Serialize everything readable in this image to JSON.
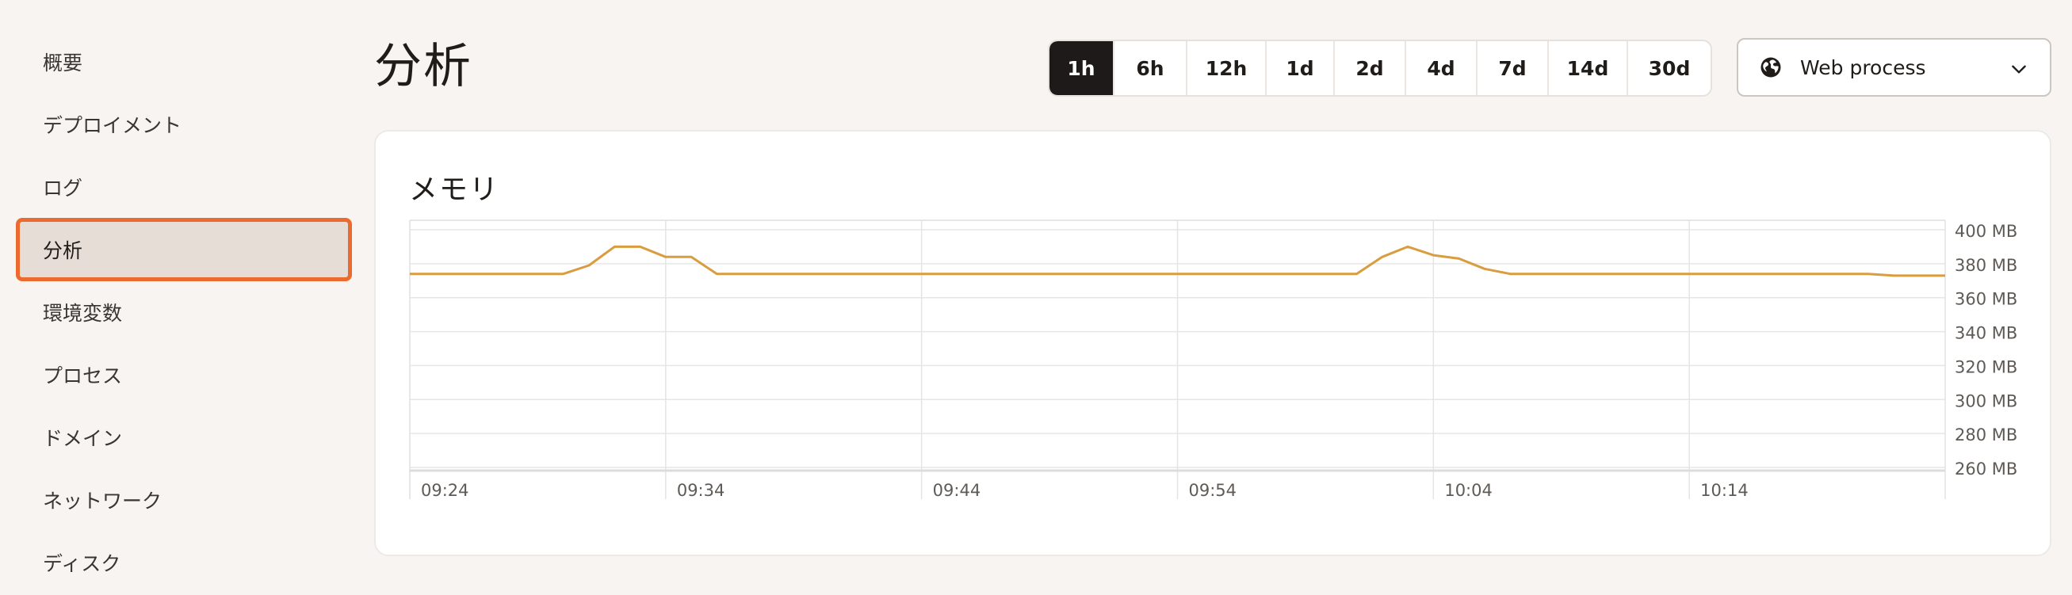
{
  "sidebar": {
    "items": [
      {
        "label": "概要",
        "name": "sidebar-item-overview",
        "active": false
      },
      {
        "label": "デプロイメント",
        "name": "sidebar-item-deployments",
        "active": false
      },
      {
        "label": "ログ",
        "name": "sidebar-item-logs",
        "active": false
      },
      {
        "label": "分析",
        "name": "sidebar-item-analytics",
        "active": true
      },
      {
        "label": "環境変数",
        "name": "sidebar-item-env-vars",
        "active": false
      },
      {
        "label": "プロセス",
        "name": "sidebar-item-processes",
        "active": false
      },
      {
        "label": "ドメイン",
        "name": "sidebar-item-domains",
        "active": false
      },
      {
        "label": "ネットワーク",
        "name": "sidebar-item-network",
        "active": false
      },
      {
        "label": "ディスク",
        "name": "sidebar-item-disk",
        "active": false
      }
    ]
  },
  "header": {
    "title": "分析",
    "ranges": [
      "1h",
      "6h",
      "12h",
      "1d",
      "2d",
      "4d",
      "7d",
      "14d",
      "30d"
    ],
    "active_range": "1h",
    "process_select": {
      "value": "Web process",
      "icon": "globe-icon",
      "chevron": "chevron-down-icon"
    }
  },
  "card": {
    "title": "メモリ"
  },
  "colors": {
    "line": "#d99c3f",
    "active_range_bg": "#1d1a19",
    "active_outline": "#ec6a2d",
    "grid": "#e8e8e8"
  },
  "chart_data": {
    "type": "line",
    "x_tick_labels": [
      "09:24",
      "09:34",
      "09:44",
      "09:54",
      "10:04",
      "10:14"
    ],
    "y_tick_labels": [
      "400 MB",
      "380 MB",
      "360 MB",
      "340 MB",
      "320 MB",
      "300 MB",
      "280 MB",
      "260 MB"
    ],
    "ylim": [
      260,
      400
    ],
    "x_start": "09:24",
    "x_end": "10:24",
    "grid": true,
    "series": [
      {
        "color": "#d99c3f",
        "x": [
          "09:24",
          "09:25",
          "09:26",
          "09:27",
          "09:28",
          "09:29",
          "09:30",
          "09:31",
          "09:32",
          "09:33",
          "09:34",
          "09:35",
          "09:36",
          "09:37",
          "09:38",
          "09:39",
          "09:40",
          "09:41",
          "09:42",
          "09:43",
          "09:44",
          "09:45",
          "09:46",
          "09:47",
          "09:48",
          "09:49",
          "09:50",
          "09:51",
          "09:52",
          "09:53",
          "09:54",
          "09:55",
          "09:56",
          "09:57",
          "09:58",
          "09:59",
          "10:00",
          "10:01",
          "10:02",
          "10:03",
          "10:04",
          "10:05",
          "10:06",
          "10:07",
          "10:08",
          "10:09",
          "10:10",
          "10:11",
          "10:12",
          "10:13",
          "10:14",
          "10:15",
          "10:16",
          "10:17",
          "10:18",
          "10:19",
          "10:20",
          "10:21",
          "10:22",
          "10:23",
          "10:24"
        ],
        "values": [
          374,
          374,
          374,
          374,
          374,
          374,
          374,
          379,
          390,
          390,
          384,
          384,
          374,
          374,
          374,
          374,
          374,
          374,
          374,
          374,
          374,
          374,
          374,
          374,
          374,
          374,
          374,
          374,
          374,
          374,
          374,
          374,
          374,
          374,
          374,
          374,
          374,
          374,
          384,
          390,
          385,
          383,
          377,
          374,
          374,
          374,
          374,
          374,
          374,
          374,
          374,
          374,
          374,
          374,
          374,
          374,
          374,
          374,
          373,
          373,
          373
        ]
      }
    ]
  }
}
